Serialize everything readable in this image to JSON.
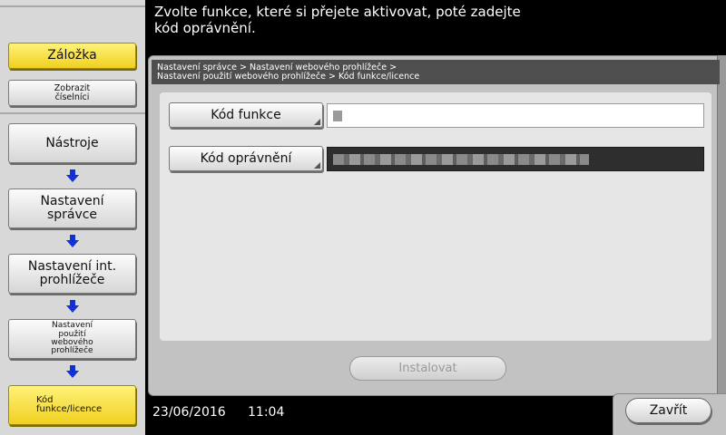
{
  "message": "Zvolte funkce, které si přejete aktivovat, poté zadejte\nkód oprávnění.",
  "sidebar": {
    "bookmark_label": "Záložka",
    "counter_label": "Zobrazit\nčíselníci",
    "nav": [
      {
        "label": "Nástroje"
      },
      {
        "label": "Nastavení\nsprávce"
      },
      {
        "label": "Nastavení int.\nprohlížeče"
      },
      {
        "label": "Nastavení\npoužití\nwebového\nprohlížeče"
      },
      {
        "label": "Kód\nfunkce/licence"
      }
    ]
  },
  "breadcrumb": "Nastavení správce > Nastavení webového prohlížeče >\nNastavení použití webového prohlížeče > Kód funkce/licence",
  "form": {
    "function_code_label": "Kód funkce",
    "auth_code_label": "Kód oprávnění"
  },
  "install_label": "Instalovat",
  "footer": {
    "date": "23/06/2016",
    "time": "11:04"
  },
  "close_label": "Zavřít",
  "colors": {
    "active_button": "#f5dc30",
    "arrow": "#1030d8",
    "header": "#000000"
  }
}
